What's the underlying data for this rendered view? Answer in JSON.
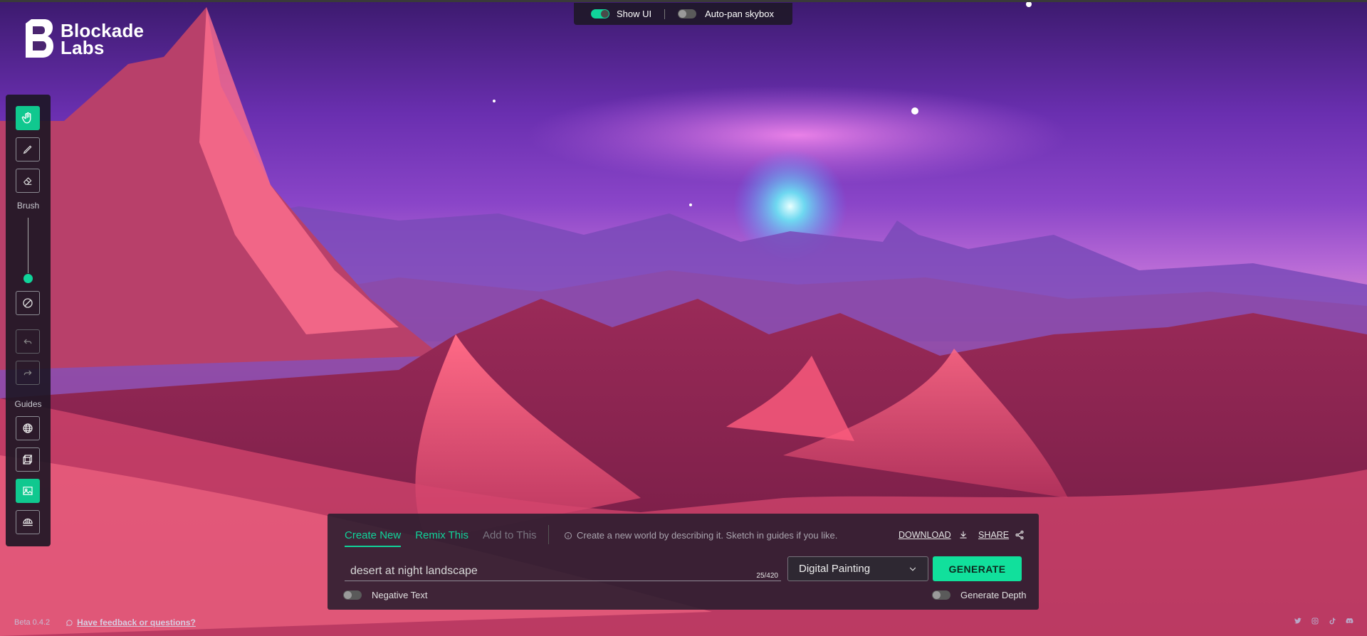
{
  "brand": {
    "name_line1": "Blockade",
    "name_line2": "Labs"
  },
  "topbar": {
    "show_ui": {
      "label": "Show UI",
      "on": true
    },
    "auto_pan": {
      "label": "Auto-pan skybox",
      "on": false
    }
  },
  "toolbar": {
    "tools": [
      {
        "name": "pan",
        "icon": "hand-icon",
        "active": true
      },
      {
        "name": "brush",
        "icon": "pencil-icon",
        "active": false
      },
      {
        "name": "eraser",
        "icon": "eraser-icon",
        "active": false
      }
    ],
    "brush_label": "Brush",
    "clear_icon": "clear-icon",
    "undo_icon": "undo-icon",
    "redo_icon": "redo-icon",
    "guides_label": "Guides",
    "guides": [
      {
        "name": "globe",
        "icon": "globe-icon",
        "active": false
      },
      {
        "name": "cube",
        "icon": "cube-icon",
        "active": false
      },
      {
        "name": "image",
        "icon": "image-icon",
        "active": true
      },
      {
        "name": "dome",
        "icon": "dome-icon",
        "active": false
      }
    ]
  },
  "panel": {
    "tabs": {
      "create": "Create New",
      "remix": "Remix This",
      "add": "Add to This"
    },
    "hint": "Create a new world by describing it. Sketch in guides if you like.",
    "download": "DOWNLOAD",
    "share": "SHARE",
    "prompt": "desert at night landscape",
    "counter": "25/420",
    "style": "Digital Painting",
    "generate": "GENERATE",
    "negative_text": {
      "label": "Negative Text",
      "on": false
    },
    "generate_depth": {
      "label": "Generate Depth",
      "on": false
    }
  },
  "footer": {
    "version": "Beta 0.4.2",
    "feedback": "Have feedback or questions?"
  },
  "social": [
    "twitter-icon",
    "instagram-icon",
    "tiktok-icon",
    "discord-icon"
  ],
  "colors": {
    "accent": "#10d49a",
    "panel": "#241c2c"
  }
}
